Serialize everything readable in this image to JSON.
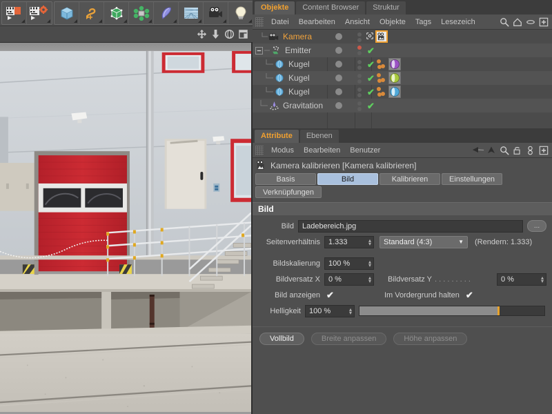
{
  "app": {
    "toolbar": {
      "render_group": [
        {
          "name": "render-view-button",
          "icon": "render-region-icon"
        },
        {
          "name": "render-settings-button",
          "icon": "render-settings-icon"
        }
      ],
      "object_group": [
        {
          "name": "cube-primitive-button",
          "icon": "cube-icon"
        },
        {
          "name": "spline-button",
          "icon": "spline-icon"
        },
        {
          "name": "nurbs-button",
          "icon": "hypernurbs-icon"
        },
        {
          "name": "array-button",
          "icon": "array-icon"
        },
        {
          "name": "deformer-button",
          "icon": "bend-deformer-icon"
        },
        {
          "name": "environment-button",
          "icon": "floor-icon"
        },
        {
          "name": "camera-button",
          "icon": "camera-icon"
        },
        {
          "name": "light-button",
          "icon": "light-bulb-icon"
        }
      ]
    },
    "viewport": {
      "image_name": "Ladebereich.jpg",
      "nav_icons": [
        "move-icon",
        "dolly-icon",
        "rotate-icon",
        "maximize-icon"
      ]
    }
  },
  "object_manager": {
    "tabs": [
      {
        "label": "Objekte",
        "active": true
      },
      {
        "label": "Content Browser",
        "active": false
      },
      {
        "label": "Struktur",
        "active": false
      }
    ],
    "menu": [
      "Datei",
      "Bearbeiten",
      "Ansicht",
      "Objekte",
      "Tags",
      "Lesezeich"
    ],
    "menu_icons": [
      "search-icon",
      "home-icon",
      "eye-icon",
      "plus-box-icon"
    ],
    "tree": [
      {
        "label": "Kamera",
        "icon": "camera-object-icon",
        "depth": 0,
        "selected": true,
        "expander": false,
        "dot2": "grey",
        "check": false,
        "tags": [
          {
            "type": "camera-calibrator-tag",
            "color": "#e6e6e6",
            "selected": true
          }
        ]
      },
      {
        "label": "Emitter",
        "icon": "emitter-object-icon",
        "depth": 0,
        "selected": false,
        "expander": true,
        "dot2": "red",
        "check": true,
        "tags": []
      },
      {
        "label": "Kugel",
        "icon": "sphere-object-icon",
        "depth": 1,
        "selected": false,
        "expander": false,
        "dot2": "grey",
        "check": true,
        "tags": [
          {
            "type": "dynamics-tag",
            "color": "#d98a3a"
          },
          {
            "type": "material-tag",
            "color": "#9b52c4"
          }
        ]
      },
      {
        "label": "Kugel",
        "icon": "sphere-object-icon",
        "depth": 1,
        "selected": false,
        "expander": false,
        "dot2": "grey",
        "check": true,
        "tags": [
          {
            "type": "dynamics-tag",
            "color": "#d98a3a"
          },
          {
            "type": "material-tag",
            "color": "#a8c83c"
          }
        ]
      },
      {
        "label": "Kugel",
        "icon": "sphere-object-icon",
        "depth": 1,
        "selected": false,
        "expander": false,
        "dot2": "grey",
        "check": true,
        "tags": [
          {
            "type": "dynamics-tag",
            "color": "#d98a3a"
          },
          {
            "type": "material-tag",
            "color": "#4fa8d8"
          }
        ]
      },
      {
        "label": "Gravitation",
        "icon": "gravity-object-icon",
        "depth": 0,
        "selected": false,
        "expander": false,
        "dot2": "grey",
        "check": true,
        "tags": []
      }
    ]
  },
  "attribute_manager": {
    "tabs": [
      {
        "label": "Attribute",
        "active": true
      },
      {
        "label": "Ebenen",
        "active": false
      }
    ],
    "menu": [
      "Modus",
      "Bearbeiten",
      "Benutzer"
    ],
    "menu_icons": [
      "back-arrow-icon",
      "forward-arrow-icon",
      "search-icon",
      "unlock-icon",
      "link-icon",
      "plus-box-icon"
    ],
    "title": "Kamera kalibrieren [Kamera kalibrieren]",
    "title_icon": "camera-calibrator-icon",
    "property_tabs": [
      {
        "label": "Basis",
        "active": false
      },
      {
        "label": "Bild",
        "active": true
      },
      {
        "label": "Kalibrieren",
        "active": false
      },
      {
        "label": "Einstellungen",
        "active": false
      },
      {
        "label": "Verknüpfungen",
        "active": false
      }
    ],
    "section_title": "Bild",
    "fields": {
      "image_label": "Bild",
      "image_value": "Ladebereich.jpg",
      "browse_label": "...",
      "aspect_label": "Seitenverhältnis",
      "aspect_value": "1.333",
      "aspect_preset": "Standard (4:3)",
      "render_note": "(Rendern: 1.333)",
      "scale_label": "Bildskalierung",
      "scale_value": "100 %",
      "offset_x_label": "Bildversatz X",
      "offset_x_value": "0 %",
      "offset_y_label": "Bildversatz Y",
      "offset_y_leader": ". . . . . . . . .",
      "offset_y_value": "0 %",
      "show_image_label": "Bild anzeigen",
      "show_image_checked": "✔",
      "foreground_label": "Im Vordergrund halten",
      "foreground_checked": "✔",
      "brightness_label": "Helligkeit",
      "brightness_value": "100 %",
      "brightness_percent": 75
    },
    "buttons": [
      {
        "label": "Vollbild",
        "enabled": true
      },
      {
        "label": "Breite anpassen",
        "enabled": false
      },
      {
        "label": "Höhe anpassen",
        "enabled": false
      }
    ]
  },
  "colors": {
    "accent_orange": "#f0a030",
    "active_tab_blue": "#a9c0dd",
    "check_green": "#5fce5f",
    "panel_bg": "#4f4f4f",
    "field_bg": "#3b3b3b"
  }
}
